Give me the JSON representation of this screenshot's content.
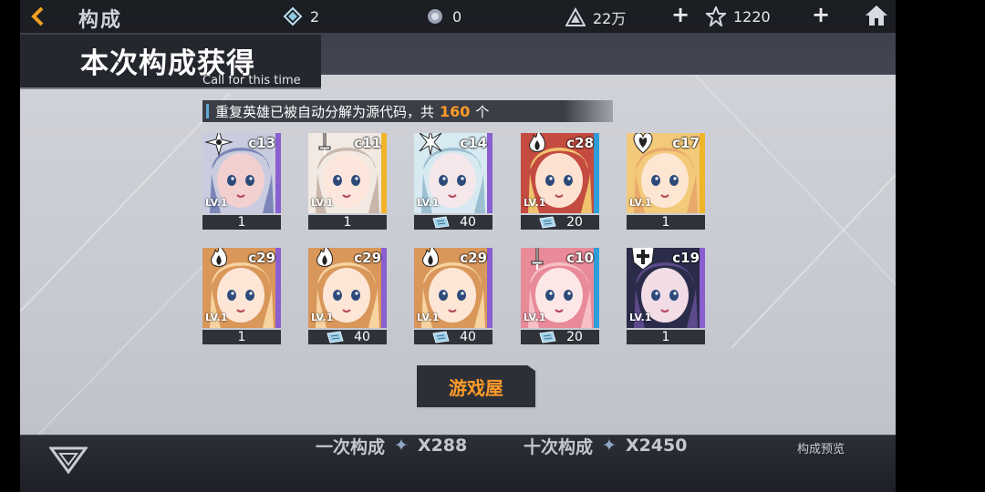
{
  "top_bar": {
    "title": "构成",
    "resources": [
      {
        "icon": "crystal-icon",
        "value": "2"
      },
      {
        "icon": "core-icon",
        "value": "0"
      },
      {
        "icon": "triangle-token-icon",
        "value": "22万"
      },
      {
        "icon": "star-chip-icon",
        "value": "1220"
      }
    ]
  },
  "panel": {
    "title": "本次构成获得",
    "subtitle": "Call for this time",
    "notice_prefix": "重复英雄已被自动分解为源代码，共",
    "notice_count": "160",
    "notice_suffix": "个"
  },
  "heroes": [
    {
      "code": "c13",
      "level": "1",
      "class_icon": "shuriken-icon",
      "rarity": "purple",
      "count": "1",
      "is_code": false,
      "palette": [
        "#c9ccdf",
        "#7a86b8",
        "#f3d0d0"
      ]
    },
    {
      "code": "c11",
      "level": "1",
      "class_icon": "sword-icon",
      "rarity": "gold",
      "count": "1",
      "is_code": false,
      "palette": [
        "#f1e9e2",
        "#c8b6aa",
        "#fde6dc"
      ]
    },
    {
      "code": "c14",
      "level": "1",
      "class_icon": "crystal-flower-icon",
      "rarity": "purple",
      "count": "40",
      "is_code": true,
      "palette": [
        "#d7e9f1",
        "#9bbfd0",
        "#f6e7ea"
      ]
    },
    {
      "code": "c28",
      "level": "1",
      "class_icon": "flame-icon",
      "rarity": "blue",
      "count": "20",
      "is_code": true,
      "palette": [
        "#c44b3f",
        "#f0c36f",
        "#fde2d2"
      ]
    },
    {
      "code": "c17",
      "level": "1",
      "class_icon": "heart-icon",
      "rarity": "gold",
      "count": "1",
      "is_code": false,
      "palette": [
        "#f3c97a",
        "#e8a96b",
        "#fde6d2"
      ]
    },
    {
      "code": "c29",
      "level": "1",
      "class_icon": "flame-icon",
      "rarity": "purple",
      "count": "1",
      "is_code": false,
      "palette": [
        "#d9975a",
        "#f6d3a0",
        "#fde6d6"
      ]
    },
    {
      "code": "c29",
      "level": "1",
      "class_icon": "flame-icon",
      "rarity": "purple",
      "count": "40",
      "is_code": true,
      "palette": [
        "#d9975a",
        "#f6d3a0",
        "#fde6d6"
      ]
    },
    {
      "code": "c29",
      "level": "1",
      "class_icon": "flame-icon",
      "rarity": "purple",
      "count": "40",
      "is_code": true,
      "palette": [
        "#d9975a",
        "#f6d3a0",
        "#fde6d6"
      ]
    },
    {
      "code": "c10",
      "level": "1",
      "class_icon": "sword-icon",
      "rarity": "blue",
      "count": "20",
      "is_code": true,
      "palette": [
        "#e88a98",
        "#f6c0c6",
        "#fde6e6"
      ]
    },
    {
      "code": "c19",
      "level": "1",
      "class_icon": "shield-cross-icon",
      "rarity": "purple",
      "count": "1",
      "is_code": false,
      "palette": [
        "#2a2c4a",
        "#5d4a8a",
        "#f2dce6"
      ]
    }
  ],
  "level_prefix": "LV.",
  "confirm_label": "游戏屋",
  "bottom_bar": {
    "single_pull_label": "一次构成",
    "single_pull_cost": "X288",
    "ten_pull_label": "十次构成",
    "ten_pull_cost": "X2450",
    "preview_label": "构成预览"
  },
  "colors": {
    "rarity_purple": "#8a5fd0",
    "rarity_gold": "#f0b429",
    "rarity_blue": "#2f9ed8",
    "accent_orange": "#ff9b2a",
    "panel_dark": "#25272e"
  }
}
